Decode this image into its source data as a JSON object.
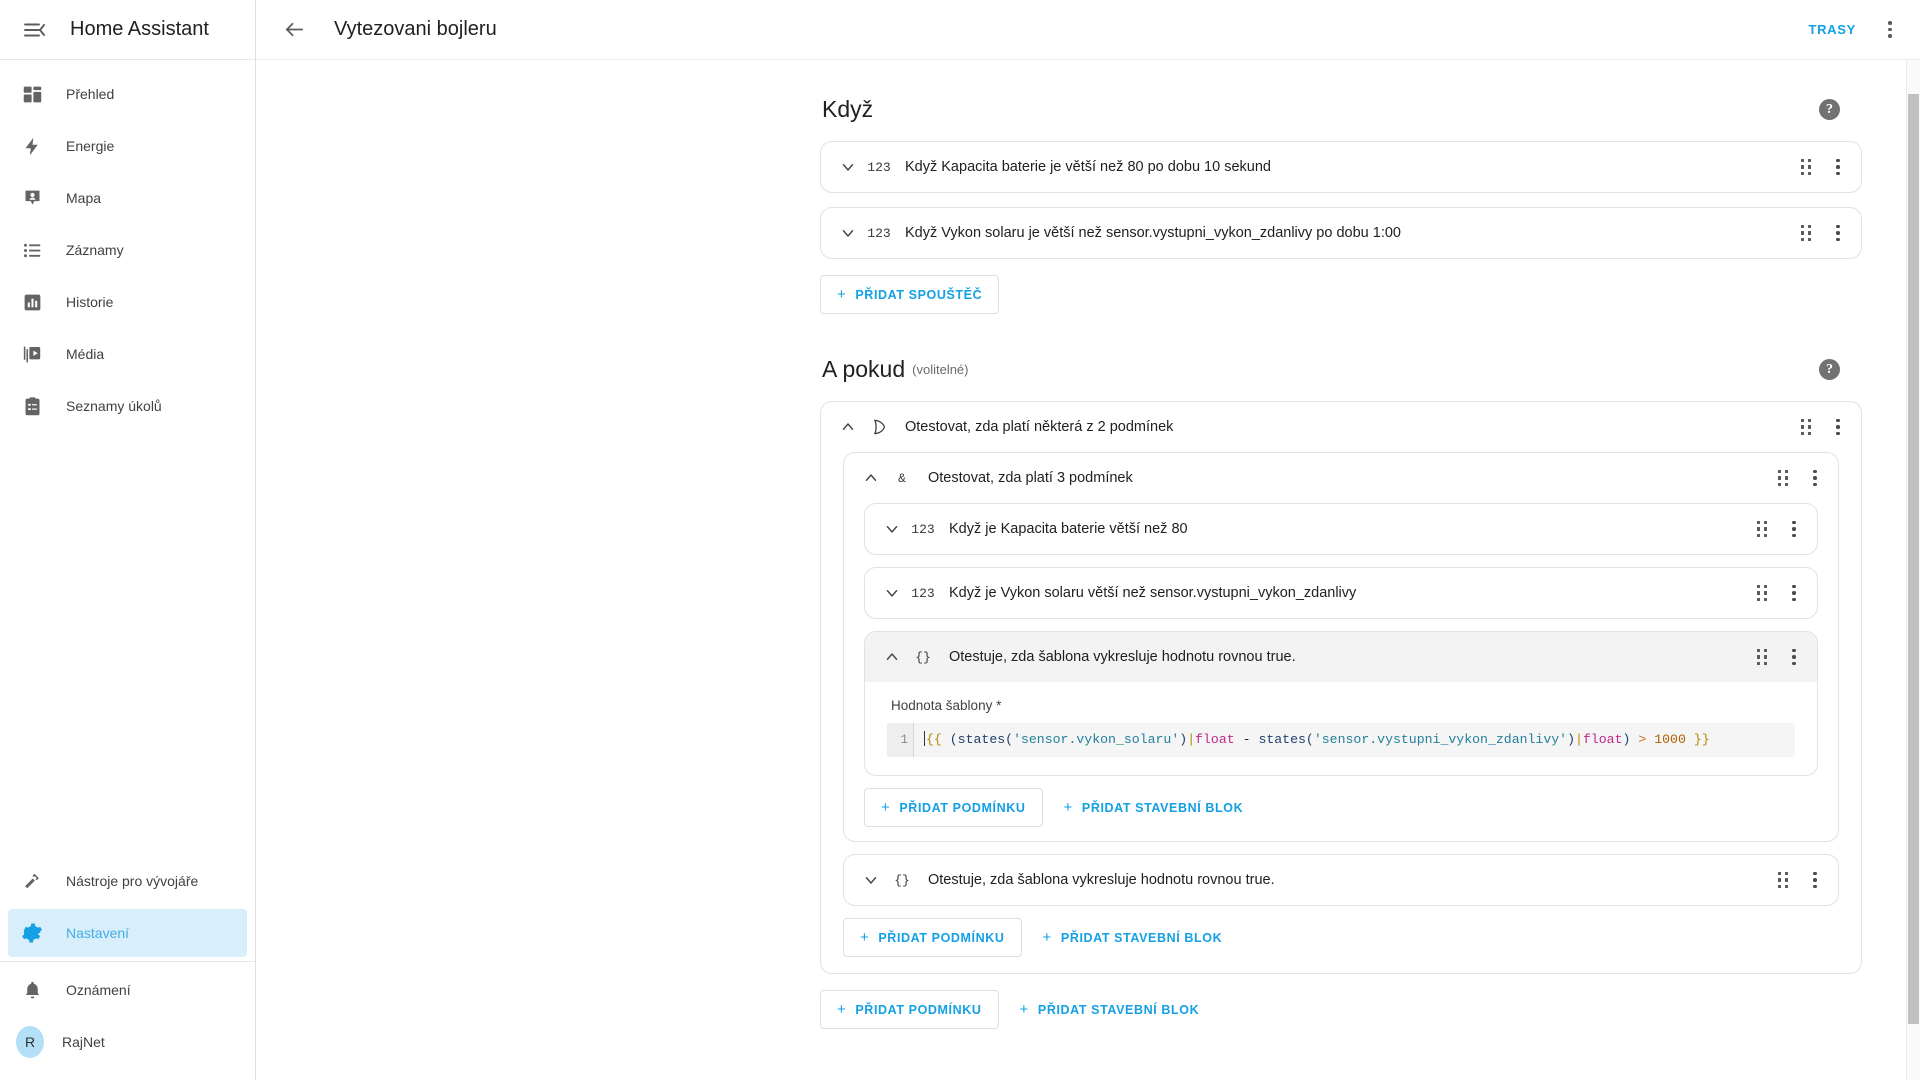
{
  "sidebar": {
    "title": "Home Assistant",
    "menu_icon": "menu-collapse-icon",
    "items": [
      {
        "label": "Přehled",
        "icon": "view-dashboard-icon",
        "active": false
      },
      {
        "label": "Energie",
        "icon": "lightning-bolt-icon",
        "active": false
      },
      {
        "label": "Mapa",
        "icon": "map-marker-account-icon",
        "active": false
      },
      {
        "label": "Záznamy",
        "icon": "format-list-bulleted-icon",
        "active": false
      },
      {
        "label": "Historie",
        "icon": "chart-box-icon",
        "active": false
      },
      {
        "label": "Média",
        "icon": "play-box-multiple-icon",
        "active": false
      },
      {
        "label": "Seznamy úkolů",
        "icon": "clipboard-list-icon",
        "active": false
      }
    ],
    "bottom_items": [
      {
        "label": "Nástroje pro vývojáře",
        "icon": "hammer-icon",
        "active": false
      },
      {
        "label": "Nastavení",
        "icon": "cog-icon",
        "active": true
      }
    ],
    "footer_items": [
      {
        "label": "Oznámení",
        "icon": "bell-icon"
      }
    ],
    "user": {
      "label": "RajNet",
      "initial": "R"
    }
  },
  "toolbar": {
    "back_icon": "arrow-left-icon",
    "title": "Vytezovani bojleru",
    "traces_label": "TRASY",
    "overflow_icon": "dots-vertical-icon"
  },
  "sections": {
    "when": {
      "title": "Když",
      "help_icon": "help-circle-icon",
      "triggers": [
        {
          "icon": "123",
          "label": "Když Kapacita baterie je větší než 80 po dobu 10 sekund",
          "expanded": false
        },
        {
          "icon": "123",
          "label": "Když Vykon solaru je větší než sensor.vystupni_vykon_zdanlivy po dobu 1:00",
          "expanded": false
        }
      ],
      "add_trigger_label": "PŘIDAT SPOUŠTĚČ"
    },
    "and_if": {
      "title": "A pokud",
      "subtitle": "(volitelné)",
      "help_icon": "help-circle-icon",
      "or_block": {
        "icon": "or-gate-icon",
        "label": "Otestovat, zda platí některá z 2 podmínek",
        "expanded": true
      },
      "and_block": {
        "icon": "and-gate-icon",
        "label": "Otestovat, zda platí 3 podmínek",
        "expanded": true,
        "conditions": [
          {
            "icon": "123",
            "label": "Když je Kapacita baterie větší než 80",
            "expanded": false
          },
          {
            "icon": "123",
            "label": "Když je Vykon solaru větší než sensor.vystupni_vykon_zdanlivy",
            "expanded": false
          }
        ],
        "template_condition": {
          "icon": "{}",
          "label": "Otestuje, zda šablona vykresluje hodnotu rovnou true.",
          "expanded": true,
          "field_label": "Hodnota šablony *",
          "line_number": "1",
          "code_tokens": [
            {
              "t": "{{",
              "c": "brace"
            },
            {
              "t": " ",
              "c": "plain"
            },
            {
              "t": "(states(",
              "c": "paren"
            },
            {
              "t": "'sensor.vykon_solaru'",
              "c": "str"
            },
            {
              "t": ")",
              "c": "paren"
            },
            {
              "t": "|",
              "c": "pipe"
            },
            {
              "t": "float",
              "c": "filter"
            },
            {
              "t": " - ",
              "c": "plain"
            },
            {
              "t": "states(",
              "c": "fn"
            },
            {
              "t": "'sensor.vystupni_vykon_zdanlivy'",
              "c": "str"
            },
            {
              "t": ")",
              "c": "paren"
            },
            {
              "t": "|",
              "c": "pipe"
            },
            {
              "t": "float",
              "c": "filter"
            },
            {
              "t": ")",
              "c": "paren"
            },
            {
              "t": " ",
              "c": "plain"
            },
            {
              "t": ">",
              "c": "op"
            },
            {
              "t": " ",
              "c": "plain"
            },
            {
              "t": "1000",
              "c": "num"
            },
            {
              "t": " ",
              "c": "plain"
            },
            {
              "t": "}}",
              "c": "brace"
            }
          ],
          "code_plain": "{{ (states('sensor.vykon_solaru')|float - states('sensor.vystupni_vykon_zdanlivy')|float) > 1000 }}"
        },
        "add_condition_label": "PŘIDAT PODMÍNKU",
        "add_building_block_label": "PŘIDAT STAVEBNÍ BLOK"
      },
      "second_template_condition": {
        "icon": "{}",
        "label": "Otestuje, zda šablona vykresluje hodnotu rovnou true.",
        "expanded": false
      },
      "add_condition_label": "PŘIDAT PODMÍNKU",
      "add_building_block_label": "PŘIDAT STAVEBNÍ BLOK"
    },
    "outer_actions": {
      "add_condition_label": "PŘIDAT PODMÍNKU",
      "add_building_block_label": "PŘIDAT STAVEBNÍ BLOK"
    }
  },
  "colors": {
    "accent": "#14a0e5",
    "active_bg": "#d8eefb",
    "border": "#e2e2e2",
    "header_bg": "#f3f3f3"
  }
}
